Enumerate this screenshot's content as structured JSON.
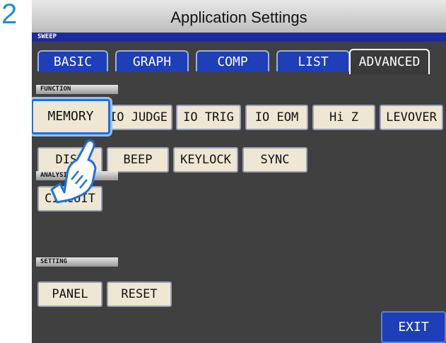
{
  "step_number": "2",
  "window_title": "Application Settings",
  "header_tag": "SWEEP",
  "tabs": [
    {
      "label": "BASIC",
      "active": false
    },
    {
      "label": "GRAPH",
      "active": false
    },
    {
      "label": "COMP",
      "active": false
    },
    {
      "label": "LIST",
      "active": false
    },
    {
      "label": "ADVANCED",
      "active": true
    }
  ],
  "sections": {
    "function": "FUNCTION",
    "analysis": "ANALYSIS",
    "setting": "SETTING"
  },
  "function_buttons": {
    "memory": "MEMORY",
    "io_judge": "IO JUDGE",
    "io_trig": "IO TRIG",
    "io_eom": "IO EOM",
    "hi_z": "Hi Z",
    "levover": "LEVOVER",
    "disp": "DISP",
    "beep": "BEEP",
    "keylock": "KEYLOCK",
    "sync": "SYNC"
  },
  "analysis_buttons": {
    "circuit": "CIRCUIT"
  },
  "setting_buttons": {
    "panel": "PANEL",
    "reset": "RESET"
  },
  "exit_label": "EXIT",
  "pointer_icon": "hand-pointer-icon",
  "colors": {
    "accent_blue": "#1e3fb8",
    "button_fill": "#eee7d3",
    "screen_bg": "#404040",
    "highlight": "#1f6fe0",
    "step_number": "#1f8fd0"
  }
}
